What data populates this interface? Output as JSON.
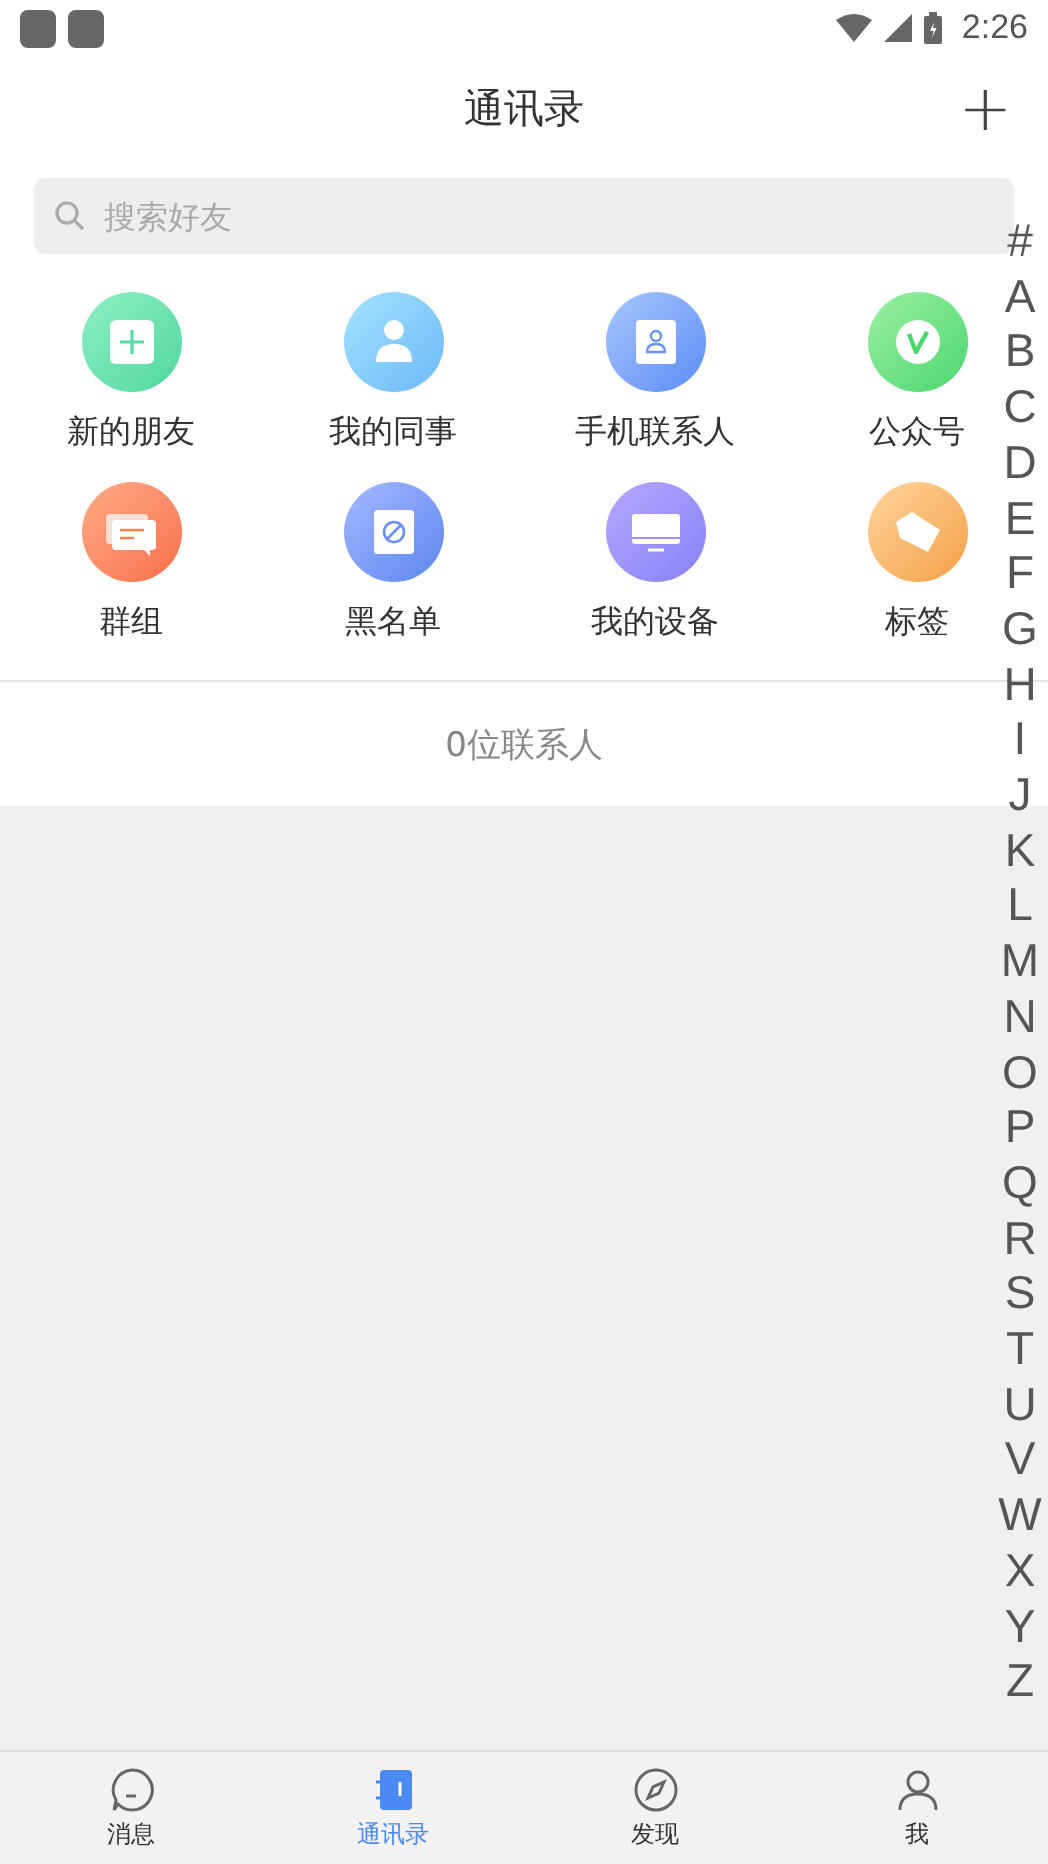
{
  "status_bar": {
    "time": "2:26"
  },
  "header": {
    "title": "通讯录",
    "add_button": "+"
  },
  "search": {
    "placeholder": "搜索好友"
  },
  "shortcuts": [
    {
      "label": "新的朋友",
      "kind": "new-friend"
    },
    {
      "label": "我的同事",
      "kind": "colleague"
    },
    {
      "label": "手机联系人",
      "kind": "phone-contact"
    },
    {
      "label": "公众号",
      "kind": "official"
    },
    {
      "label": "群组",
      "kind": "group"
    },
    {
      "label": "黑名单",
      "kind": "blacklist"
    },
    {
      "label": "我的设备",
      "kind": "device"
    },
    {
      "label": "标签",
      "kind": "tag"
    }
  ],
  "contact_count": "0位联系人",
  "index": [
    "#",
    "A",
    "B",
    "C",
    "D",
    "E",
    "F",
    "G",
    "H",
    "I",
    "J",
    "K",
    "L",
    "M",
    "N",
    "O",
    "P",
    "Q",
    "R",
    "S",
    "T",
    "U",
    "V",
    "W",
    "X",
    "Y",
    "Z"
  ],
  "tabs": [
    {
      "label": "消息",
      "kind": "chat",
      "selected": false
    },
    {
      "label": "通讯录",
      "kind": "contacts",
      "selected": true
    },
    {
      "label": "发现",
      "kind": "discover",
      "selected": false
    },
    {
      "label": "我",
      "kind": "me",
      "selected": false
    }
  ]
}
